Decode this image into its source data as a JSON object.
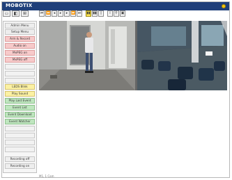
{
  "header": {
    "brand": "MOBOTIX"
  },
  "colors": {
    "brand_bar": "#1f3f7a",
    "status_led": "#f2c40f"
  },
  "top_icons": [
    "window-icon",
    "layout-icon",
    "grid-icon"
  ],
  "toolbar": {
    "buttons": [
      "first-icon",
      "rewind-icon",
      "prev-icon",
      "play-icon",
      "next-icon",
      "forward-icon",
      "last-icon",
      "live-icon",
      "live2-icon",
      "mark-icon",
      "info-icon",
      "search-icon",
      "save-icon"
    ]
  },
  "sidebar": {
    "items": [
      {
        "label": "Admin Menu",
        "style": "grey"
      },
      {
        "label": "Setup Menu",
        "style": "grey"
      },
      {
        "label": "Arm & Record",
        "style": "pink"
      },
      {
        "label": "Audio on",
        "style": "pink"
      },
      {
        "label": "MxPEG on",
        "style": "pink"
      },
      {
        "label": "MxPEG off",
        "style": "pink"
      },
      {
        "label": "",
        "style": "empty"
      },
      {
        "label": "",
        "style": "empty"
      },
      {
        "label": "",
        "style": "empty"
      },
      {
        "label": "LEDS Blink",
        "style": "yellow"
      },
      {
        "label": "Play Sound",
        "style": "yellow"
      },
      {
        "label": "Play Last Event",
        "style": "green"
      },
      {
        "label": "Event List",
        "style": "green"
      },
      {
        "label": "Event Download",
        "style": "green"
      },
      {
        "label": "Event Watcher",
        "style": "green"
      },
      {
        "label": "",
        "style": "empty"
      },
      {
        "label": "",
        "style": "empty"
      },
      {
        "label": "",
        "style": "empty"
      },
      {
        "label": "",
        "style": "empty"
      },
      {
        "label": "Recording off",
        "style": "grey"
      },
      {
        "label": "Recording on",
        "style": "grey"
      },
      {
        "label": "",
        "style": "empty"
      }
    ]
  },
  "status_text": "M1, 1 Cam"
}
